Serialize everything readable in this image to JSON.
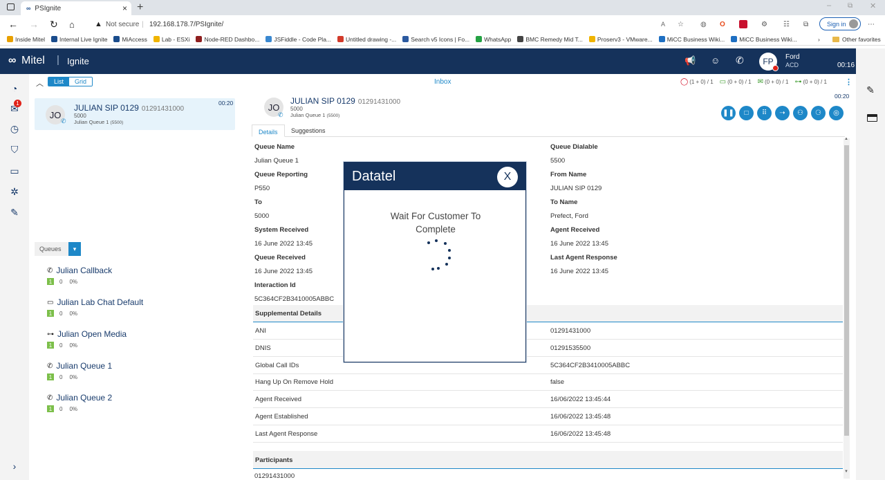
{
  "browser": {
    "tab_title": "PSIgnite",
    "security_label": "Not secure",
    "url": "192.168.178.7/PSIgnite/",
    "sign_in": "Sign in",
    "other_favorites": "Other favorites",
    "bookmarks": [
      {
        "label": "Inside Mitel",
        "color": "#e8a000"
      },
      {
        "label": "Internal Live Ignite",
        "color": "#1a4c8c"
      },
      {
        "label": "MiAccess",
        "color": "#1a4c8c"
      },
      {
        "label": "Lab - ESXi",
        "color": "#f0b400"
      },
      {
        "label": "Node-RED Dashbo...",
        "color": "#8f1f1f"
      },
      {
        "label": "JSFiddle - Code Pla...",
        "color": "#3a88d0"
      },
      {
        "label": "Untitled drawing -...",
        "color": "#d23a2a"
      },
      {
        "label": "Search v5 Icons | Fo...",
        "color": "#2c5aa0"
      },
      {
        "label": "WhatsApp",
        "color": "#25a244"
      },
      {
        "label": "BMC Remedy Mid T...",
        "color": "#444444"
      },
      {
        "label": "Proserv3 - VMware...",
        "color": "#f0b400"
      },
      {
        "label": "MiCC Business Wiki...",
        "color": "#1e6fc2"
      },
      {
        "label": "MiCC Business Wiki...",
        "color": "#1e6fc2"
      }
    ]
  },
  "app": {
    "brand": "Mitel",
    "product": "Ignite",
    "user_initials": "FP",
    "user_name": "Ford",
    "user_mode": "ACD",
    "timer": "00:16"
  },
  "nav": {
    "inbox_badge": "1"
  },
  "left": {
    "view_list": "List",
    "view_grid": "Grid",
    "interaction": {
      "initials": "JO",
      "name": "JULIAN SIP 0129",
      "number": "01291431000",
      "ext": "5000",
      "queue": "Julian Queue 1",
      "queue_num": "(5500)",
      "time": "00:20"
    },
    "queues_label": "Queues",
    "queues": [
      {
        "name": "Julian Callback",
        "icon": "phone-icon",
        "a": "1",
        "b": "0",
        "c": "0%"
      },
      {
        "name": "Julian Lab Chat Default",
        "icon": "chat-icon",
        "a": "1",
        "b": "0",
        "c": "0%"
      },
      {
        "name": "Julian Open Media",
        "icon": "open-media-icon",
        "a": "1",
        "b": "0",
        "c": "0%"
      },
      {
        "name": "Julian Queue 1",
        "icon": "phone-icon",
        "a": "1",
        "b": "0",
        "c": "0%"
      },
      {
        "name": "Julian Queue 2",
        "icon": "phone-icon",
        "a": "1",
        "b": "0",
        "c": "0%"
      }
    ]
  },
  "main": {
    "inbox_title": "Inbox",
    "counters": [
      {
        "text": "(1 + 0) / 1",
        "color": "#d0021b"
      },
      {
        "text": "(0 + 0) / 1",
        "color": "#3a9a2a"
      },
      {
        "text": "(0 + 0) / 1",
        "color": "#3a9a2a"
      },
      {
        "text": "(0 + 0) / 1",
        "color": "#3a9a2a"
      }
    ],
    "timer": "00:20",
    "contact": {
      "initials": "JO",
      "name": "JULIAN SIP 0129",
      "number": "01291431000",
      "ext": "5000",
      "queue": "Julian Queue 1",
      "queue_num": "(5500)"
    },
    "tabs": [
      "Details",
      "Suggestions"
    ],
    "details_left": [
      {
        "label": "Queue Name",
        "value": "Julian Queue 1"
      },
      {
        "label": "Queue Reporting",
        "value": "P550"
      },
      {
        "label": "To",
        "value": "5000"
      },
      {
        "label": "System Received",
        "value": "16 June 2022 13:45"
      },
      {
        "label": "Queue Received",
        "value": "16 June 2022 13:45"
      },
      {
        "label": "Interaction Id",
        "value": "5C364CF2B3410005ABBC"
      }
    ],
    "details_right": [
      {
        "label": "Queue Dialable",
        "value": "5500"
      },
      {
        "label": "From Name",
        "value": "JULIAN SIP 0129"
      },
      {
        "label": "To Name",
        "value": "Prefect, Ford"
      },
      {
        "label": "Agent Received",
        "value": "16 June 2022 13:45"
      },
      {
        "label": "Last Agent Response",
        "value": "16 June 2022 13:45"
      }
    ],
    "supplemental_title": "Supplemental Details",
    "supplemental": [
      {
        "label": "ANI",
        "value": "01291431000"
      },
      {
        "label": "DNIS",
        "value": "01291535500"
      },
      {
        "label": "Global Call IDs",
        "value": "5C364CF2B3410005ABBC"
      },
      {
        "label": "Hang Up On Remove Hold",
        "value": "false"
      },
      {
        "label": "Agent Received",
        "value": "16/06/2022 13:45:44"
      },
      {
        "label": "Agent Established",
        "value": "16/06/2022 13:45:48"
      },
      {
        "label": "Last Agent Response",
        "value": "16/06/2022 13:45:48"
      }
    ],
    "participants_title": "Participants",
    "participant_first": "01291431000"
  },
  "modal": {
    "title": "Datatel",
    "close": "X",
    "message": "Wait For Customer To Complete"
  }
}
